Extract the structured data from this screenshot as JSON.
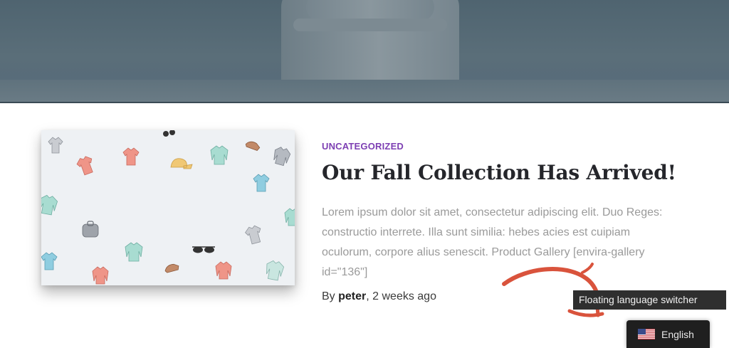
{
  "post": {
    "category": "UNCATEGORIZED",
    "title": "Our Fall Collection Has Arrived!",
    "excerpt": "Lorem ipsum dolor sit amet, consectetur adipiscing elit. Duo Reges: constructio interrete. Illa sunt similia: hebes acies est cuipiam oculorum, corpore alius senescit. Product Gallery [envira-gallery id=\"136\"]",
    "byline_prefix": "By ",
    "author": "peter",
    "date_suffix": ", 2 weeks ago"
  },
  "annotation": {
    "tooltip": "Floating language switcher"
  },
  "language_switcher": {
    "flag_icon": "us-flag-icon",
    "label": "English"
  },
  "colors": {
    "category": "#7d3fb3",
    "title": "#25262b",
    "excerpt": "#9a9a9a",
    "annotation_arrow": "#d9533c",
    "switcher_bg": "#1f1f1f"
  }
}
